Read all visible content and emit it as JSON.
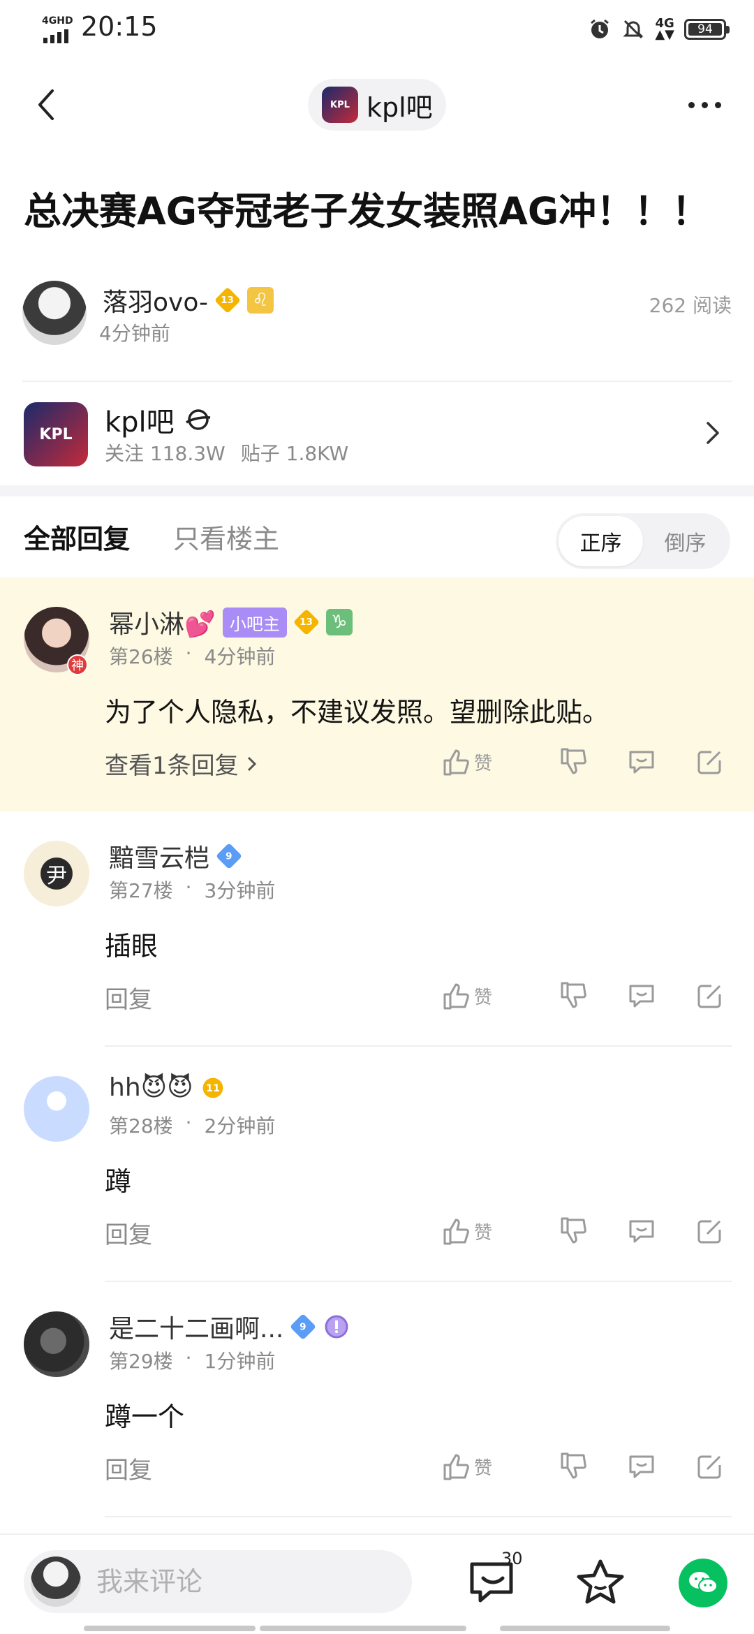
{
  "status_bar": {
    "network": "4GHD",
    "time": "20:15",
    "mobile": "4G",
    "battery": "94"
  },
  "nav": {
    "forum_chip": "kpl吧",
    "logo_text": "KPL"
  },
  "post": {
    "title": "总决赛AG夺冠老子发女装照AG冲！！！",
    "author": {
      "name": "落羽ovo-",
      "level": "13",
      "zodiac_symbol": "♌",
      "time": "4分钟前"
    },
    "read_count": "262 阅读"
  },
  "forum": {
    "name": "kpl吧",
    "logo_text": "KPL",
    "followers": "关注 118.3W",
    "posts": "贴子 1.8KW"
  },
  "tabs": {
    "all": "全部回复",
    "owner_only": "只看楼主",
    "sort_asc": "正序",
    "sort_desc": "倒序"
  },
  "comments": [
    {
      "name": "幂小淋💕",
      "mod_tag": "小吧主",
      "level": "13",
      "zodiac_symbol": "♑",
      "avatar_tag": "神",
      "floor": "第26楼",
      "time": "4分钟前",
      "body": "为了个人隐私，不建议发照。望删除此贴。",
      "reply_label": "查看1条回复",
      "like_label": "赞"
    },
    {
      "name": "黯雪云桤",
      "level": "9",
      "avatar_glyph": "尹",
      "floor": "第27楼",
      "time": "3分钟前",
      "body": "插眼",
      "reply_label": "回复",
      "like_label": "赞"
    },
    {
      "name": "hh😈😈",
      "level": "11",
      "floor": "第28楼",
      "time": "2分钟前",
      "body": "蹲",
      "reply_label": "回复",
      "like_label": "赞"
    },
    {
      "name": "是二十二画啊...",
      "level": "9",
      "floor": "第29楼",
      "time": "1分钟前",
      "body": "蹲一个",
      "reply_label": "回复",
      "like_label": "赞"
    }
  ],
  "meta_separator": "·",
  "bottom_bar": {
    "placeholder": "我来评论",
    "comment_count": "30"
  },
  "colors": {
    "pinned_bg": "#fdf9e2",
    "level_badge": "#f4b400",
    "mod_tag": "#a98cf5",
    "blue_badge": "#5b9cf5",
    "wechat": "#07c160"
  }
}
